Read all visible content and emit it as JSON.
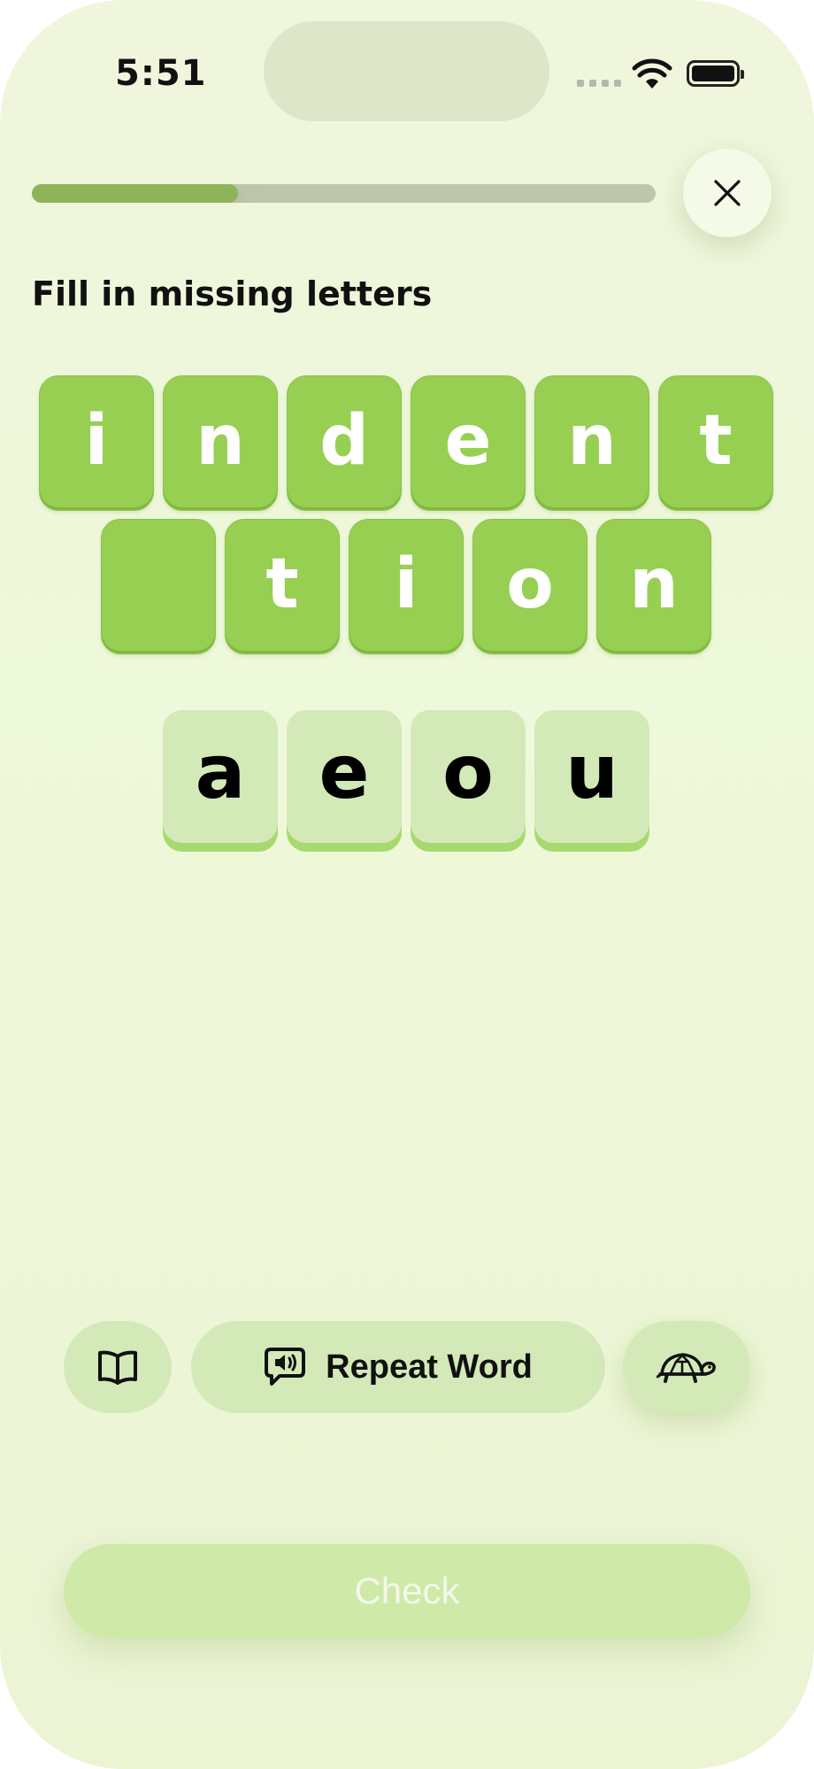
{
  "status_bar": {
    "time": "5:51"
  },
  "progress": {
    "fraction": 0.33
  },
  "instruction": "Fill in missing letters",
  "word_row1": [
    "i",
    "n",
    "d",
    "e",
    "n",
    "t"
  ],
  "word_row2": [
    "",
    "t",
    "i",
    "o",
    "n"
  ],
  "choices": [
    "a",
    "e",
    "o",
    "u"
  ],
  "buttons": {
    "repeat_word": "Repeat Word",
    "check": "Check"
  },
  "icons": {
    "close": "close-icon",
    "dictionary": "book-icon",
    "speak": "speech-bubble-speaker-icon",
    "slow": "turtle-icon"
  },
  "colors": {
    "tile": "#97cf52",
    "choice": "#d3eab8",
    "progress_fill": "#8eb45a",
    "check": "#cfe9a8"
  }
}
